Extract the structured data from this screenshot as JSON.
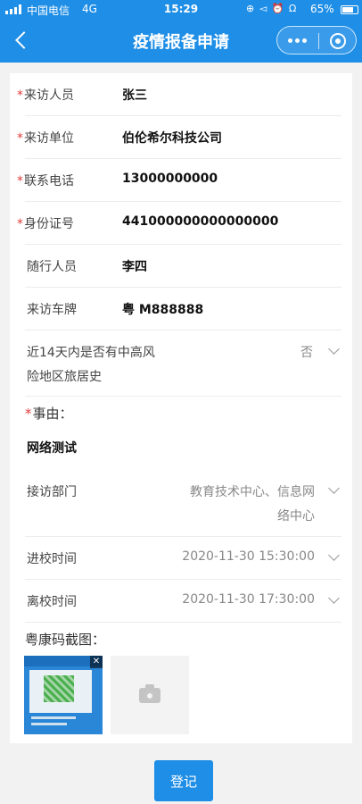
{
  "status_bar": {
    "carrier": "中国电信",
    "network": "4G",
    "time": "15:29",
    "icons": "⊕ ◅ ⏰ Ω",
    "battery": "65%"
  },
  "nav": {
    "title": "疫情报备申请"
  },
  "colors": {
    "primary": "#1e8ee6",
    "required": "#e03c3c"
  },
  "form": {
    "rows": [
      {
        "label": "来访人员",
        "value": "张三",
        "required": true
      },
      {
        "label": "来访单位",
        "value": "伯伦希尔科技公司",
        "required": true
      },
      {
        "label": "联系电话",
        "value": "13000000000",
        "required": true
      },
      {
        "label": "身份证号",
        "value": "441000000000000000",
        "required": true
      },
      {
        "label": "随行人员",
        "value": "李四",
        "required": false
      },
      {
        "label": "来访车牌",
        "value": "粤 M888888",
        "required": false
      }
    ],
    "risk": {
      "label_line1": "近14天内是否有中高风",
      "label_line2": "险地区旅居史",
      "value": "否"
    },
    "reason": {
      "label": "事由：",
      "value": "网络测试",
      "required_mark": "*"
    },
    "department": {
      "label": "接访部门",
      "value_line1": "教育技术中心、信息网",
      "value_line2": "络中心"
    },
    "enter_time": {
      "label": "进校时间",
      "value": "2020-11-30 15:30:00"
    },
    "leave_time": {
      "label": "离校时间",
      "value": "2020-11-30 17:30:00"
    },
    "health_code": {
      "label": "粤康码截图：",
      "delete": "✕"
    },
    "required_mark": "*"
  },
  "submit_label": "登记"
}
